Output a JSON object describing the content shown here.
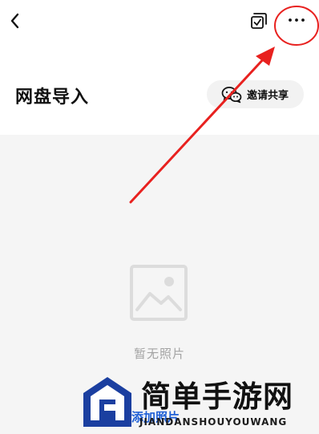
{
  "header": {
    "back_icon": "chevron-left-icon",
    "select_icon": "multi-select-check-icon",
    "more_icon": "more-dots-icon",
    "title": "网盘导入",
    "invite": {
      "icon": "wechat-icon",
      "label": "邀请共享"
    }
  },
  "empty_state": {
    "icon": "image-placeholder-icon",
    "text": "暂无照片",
    "add_label": "添加照片"
  },
  "watermark": {
    "title": "简单手游网",
    "subtitle": "JIANDANSHOUYOUWANG"
  },
  "colors": {
    "annotation_red": "#e8211f",
    "link_blue": "#1e5fd6",
    "header_bg": "#ffffff",
    "content_bg": "#f5f5f5"
  }
}
